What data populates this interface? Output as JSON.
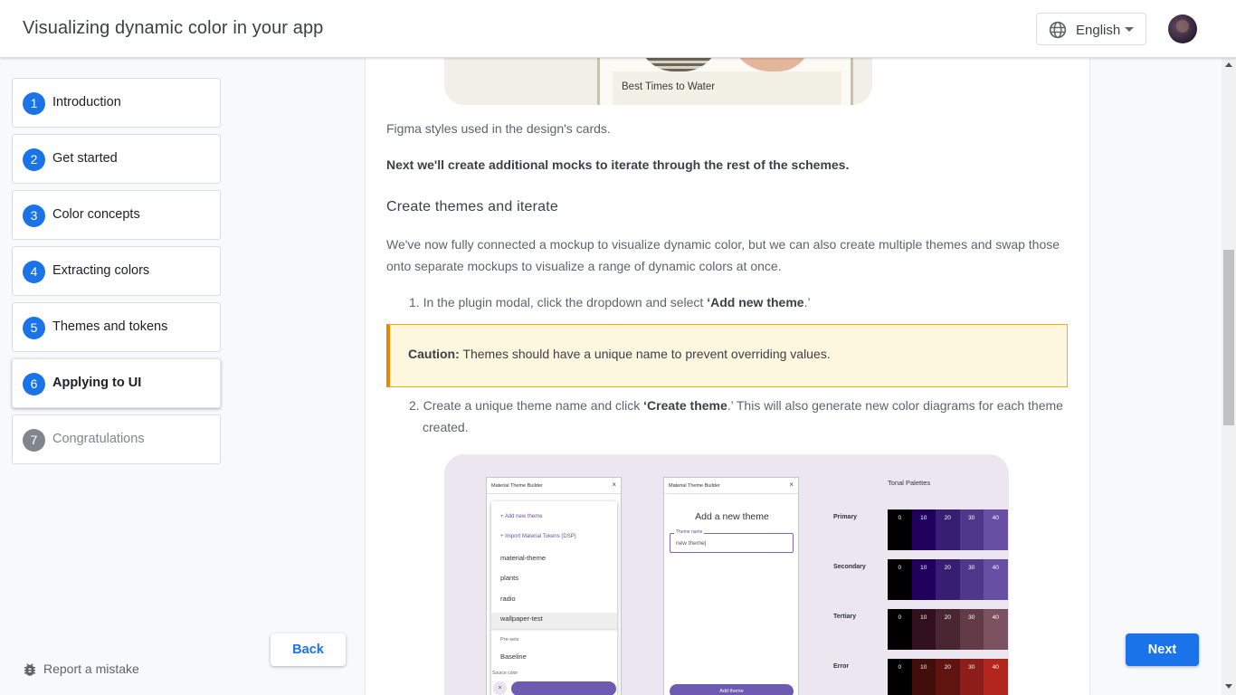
{
  "header": {
    "title": "Visualizing dynamic color in your app",
    "language": "English",
    "icons": {
      "language": "globe-icon",
      "menu": "caret-down-icon",
      "avatar": "user-avatar"
    }
  },
  "steps": [
    {
      "number": "1",
      "label": "Introduction",
      "state": "done"
    },
    {
      "number": "2",
      "label": "Get started",
      "state": "done"
    },
    {
      "number": "3",
      "label": "Color concepts",
      "state": "done"
    },
    {
      "number": "4",
      "label": "Extracting colors",
      "state": "done"
    },
    {
      "number": "5",
      "label": "Themes and tokens",
      "state": "done"
    },
    {
      "number": "6",
      "label": "Applying to UI",
      "state": "active"
    },
    {
      "number": "7",
      "label": "Congratulations",
      "state": "future"
    }
  ],
  "footer": {
    "report_label": "Report a mistake",
    "report_icon": "bug-icon",
    "back_label": "Back",
    "next_label": "Next"
  },
  "content": {
    "top_image": {
      "card_label": "Best Times to Water"
    },
    "caption": "Figma styles used in the design's cards.",
    "next_text": "Next we'll create additional mocks to iterate through the rest of the schemes.",
    "section_heading": "Create themes and iterate",
    "intro_paragraph_line1": "We've now fully connected a mockup to visualize dynamic color, but we can also create multiple themes and swap those",
    "intro_paragraph_line2": "onto separate mockups to visualize a range of dynamic colors at once.",
    "list": {
      "item1_num": "1.",
      "item1_pre": "In the plugin modal, click the dropdown and select ",
      "item1_bold": "‘Add new theme",
      "item1_post": ".’",
      "item2_num": "2.",
      "item2_pre": "Create a unique theme name and click ",
      "item2_bold": "‘Create theme",
      "item2_post": ".’ This will also generate new color diagrams for each theme",
      "item2_line2": "created."
    },
    "caution": {
      "label": "Caution:",
      "text": " Themes should have a unique name to prevent overriding values."
    }
  },
  "diagram": {
    "panel1": {
      "title": "Material Theme Builder",
      "close": "×",
      "items": [
        "+ Add new theme",
        "+ Import Material Tokens (DSP)",
        "material-theme",
        "plants",
        "radio",
        "wallpaper-test"
      ],
      "presets_label": "Pre-sets",
      "preset_item": "Baseline",
      "source_label": "Source color",
      "clear": "×"
    },
    "panel2": {
      "title": "Material Theme Builder",
      "close": "×",
      "heading": "Add a new theme",
      "field_label": "Theme name",
      "field_value": "new theme|",
      "button": "Add theme"
    },
    "tonal": {
      "title": "Tonal Palettes",
      "tones": [
        "0",
        "10",
        "20",
        "30",
        "40"
      ],
      "palettes": [
        {
          "name": "Primary",
          "colors": [
            "#000000",
            "#21005d",
            "#381e72",
            "#4f378b",
            "#6750a4"
          ]
        },
        {
          "name": "Secondary",
          "colors": [
            "#000000",
            "#21005d",
            "#381e72",
            "#4f378b",
            "#6750a4"
          ]
        },
        {
          "name": "Tertiary",
          "colors": [
            "#000000",
            "#31111d",
            "#4a2532",
            "#633b48",
            "#7d5260"
          ]
        },
        {
          "name": "Error",
          "colors": [
            "#000000",
            "#410e0b",
            "#601410",
            "#8c1d18",
            "#b3261e"
          ]
        }
      ]
    }
  },
  "colors": {
    "accent": "#1a73e8",
    "caution_bg": "#fef7e0",
    "caution_border": "#ea8600"
  }
}
